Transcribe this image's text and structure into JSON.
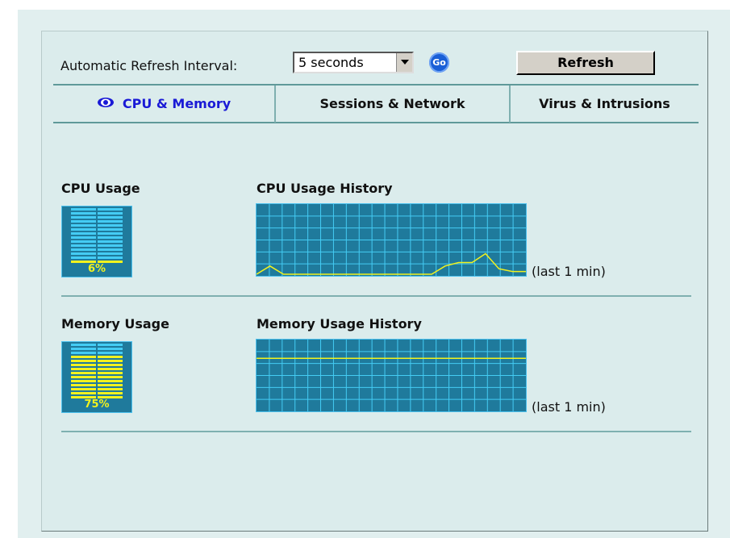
{
  "toolbar": {
    "refresh_interval_label": "Automatic Refresh Interval:",
    "refresh_interval_value": "5 seconds",
    "go_label": "Go",
    "refresh_label": "Refresh"
  },
  "tabs": [
    {
      "label": "CPU & Memory",
      "active": true
    },
    {
      "label": "Sessions & Network",
      "active": false
    },
    {
      "label": "Virus & Intrusions",
      "active": false
    }
  ],
  "cpu": {
    "label": "CPU Usage",
    "percent_text": "6%",
    "percent": 6,
    "history_label": "CPU Usage History",
    "history_caption": "(last 1 min)",
    "history_values": [
      0,
      12,
      0,
      0,
      0,
      0,
      0,
      0,
      0,
      0,
      0,
      0,
      0,
      0,
      12,
      17,
      17,
      30,
      8,
      4,
      4
    ]
  },
  "memory": {
    "label": "Memory Usage",
    "percent_text": "75%",
    "percent": 75,
    "history_label": "Memory Usage History",
    "history_caption": "(last 1 min)",
    "history_values": [
      75,
      75,
      75,
      75,
      75,
      75,
      75,
      75,
      75,
      75,
      75,
      75,
      75,
      75,
      75,
      75,
      75,
      75,
      75,
      75,
      75
    ]
  },
  "colors": {
    "meter_bg": "#1f7a9c",
    "meter_idle": "#44ccf4",
    "meter_used": "#f2f21e",
    "active_tab": "#1a1ad6"
  }
}
